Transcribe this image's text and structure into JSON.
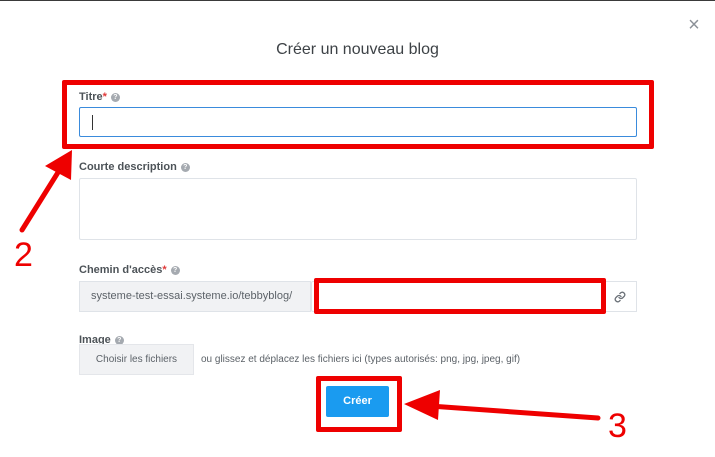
{
  "modal": {
    "title": "Créer un nouveau blog",
    "close_glyph": "×"
  },
  "fields": {
    "title": {
      "label": "Titre",
      "required_mark": "*",
      "value": "",
      "help_icon": "question-circle-icon"
    },
    "description": {
      "label": "Courte description",
      "value": "",
      "help_icon": "question-circle-icon"
    },
    "path": {
      "label": "Chemin d'accès",
      "required_mark": "*",
      "prefix": "systeme-test-essai.systeme.io/tebbyblog/",
      "value": "",
      "help_icon": "question-circle-icon",
      "link_icon": "link-icon"
    },
    "image": {
      "label": "Image",
      "button_label": "Choisir les fichiers",
      "drop_hint": "ou glissez et déplacez les fichiers ici (types autorisés: png, jpg, jpeg, gif)",
      "help_icon": "question-circle-icon"
    }
  },
  "submit_label": "Créer",
  "annotations": {
    "step_2": "2",
    "step_3": "3",
    "color": "#ee0000"
  },
  "colors": {
    "accent": "#1a9bf0",
    "focus_border": "#3a8bdc",
    "required": "#e03a3a"
  }
}
